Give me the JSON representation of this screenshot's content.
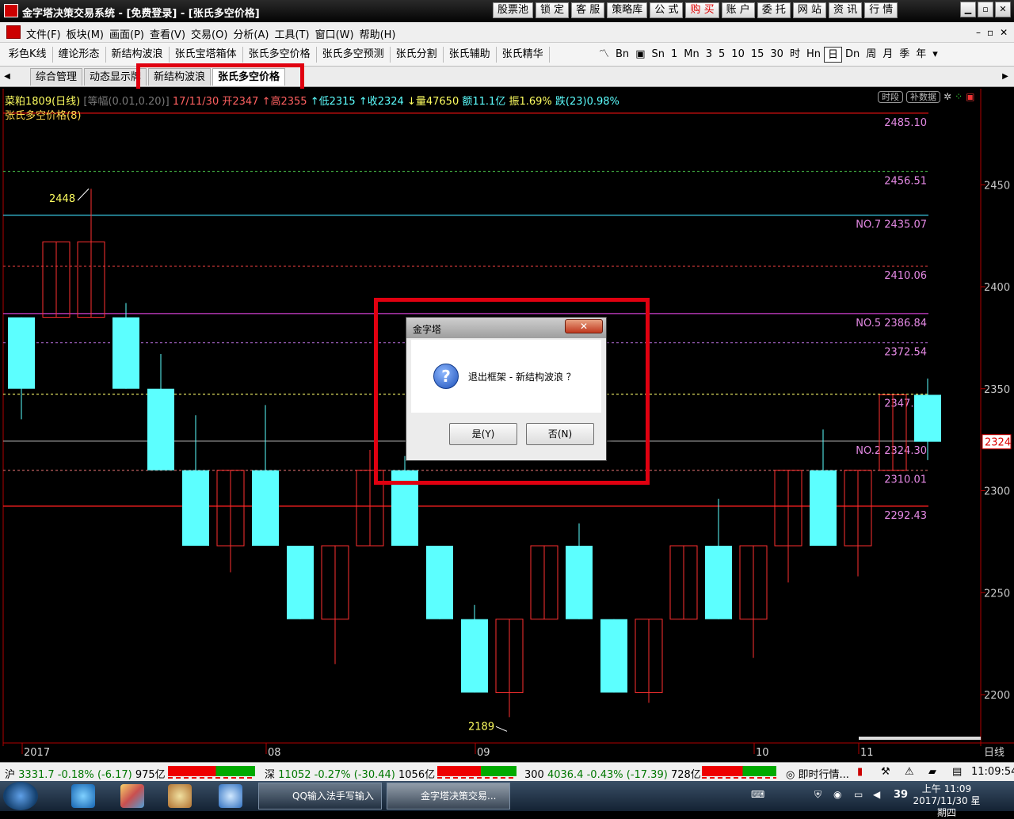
{
  "window": {
    "title": "金字塔决策交易系统 - [免费登录] - [张氏多空价格]",
    "top_buttons": [
      "股票池",
      "锁 定",
      "客 服",
      "策略库",
      "公 式",
      "购 买",
      "账 户",
      "委 托",
      "网 站",
      "资 讯",
      "行 情"
    ],
    "controls": [
      "▁",
      "▫",
      "✕"
    ]
  },
  "menu": {
    "items": [
      "文件(F)",
      "板块(M)",
      "画面(P)",
      "查看(V)",
      "交易(O)",
      "分析(A)",
      "工具(T)",
      "窗口(W)",
      "帮助(H)"
    ],
    "child_controls": [
      "–",
      "▫",
      "✕"
    ]
  },
  "toolbar": {
    "items": [
      "彩色K线",
      "缠论形态",
      "新结构波浪",
      "张氏宝塔箱体",
      "张氏多空价格",
      "张氏多空预测",
      "张氏分割",
      "张氏辅助",
      "张氏精华"
    ],
    "periods": [
      "Bn",
      "Sn",
      "1",
      "Mn",
      "3",
      "5",
      "10",
      "15",
      "30",
      "时",
      "Hn",
      "日",
      "Dn",
      "周",
      "月",
      "季",
      "年"
    ],
    "selected_period": "日"
  },
  "tabs": {
    "items": [
      "综合管理",
      "动态显示牌",
      "新结构波浪",
      "张氏多空价格"
    ],
    "active": "张氏多空价格"
  },
  "chart": {
    "info": {
      "symbol": "菜粕1809(日线)",
      "scale": "[等幅(0.01,0.20)]",
      "date": "17/11/30",
      "open": "开2347",
      "high": "↑高2355",
      "low": "↑低2315",
      "close": "↑收2324",
      "vol": "↓量47650",
      "amount": "额11.1亿",
      "amp": "振1.69%",
      "change": "跌(23)0.98%"
    },
    "indicator": "张氏多空价格(8)",
    "buttons": [
      "时段",
      "补数据"
    ],
    "level_labels": [
      "2485.10",
      "2456.51",
      "NO.7 2435.07",
      "2410.06",
      "NO.5 2386.84",
      "2372.54",
      "2347.33",
      "NO.2 2324.30",
      "2310.01",
      "2292.43"
    ],
    "y_ticks": [
      "2450",
      "2400",
      "2350",
      "2300",
      "2250",
      "2200"
    ],
    "x_labels": [
      "2017",
      "08",
      "09",
      "10",
      "11"
    ],
    "period_label": "日线",
    "last_price": "2324",
    "high_mark": "2448",
    "low_mark": "2189"
  },
  "chart_data": {
    "type": "candlestick",
    "ylim": [
      2180,
      2500
    ],
    "candles": [
      {
        "o": 2385,
        "c": 2350,
        "h": 2385,
        "l": 2335
      },
      {
        "o": 2385,
        "c": 2422,
        "h": 2422,
        "l": 2385
      },
      {
        "o": 2385,
        "c": 2422,
        "h": 2448,
        "l": 2385
      },
      {
        "o": 2385,
        "c": 2350,
        "h": 2392,
        "l": 2350
      },
      {
        "o": 2350,
        "c": 2310,
        "h": 2367,
        "l": 2310
      },
      {
        "o": 2310,
        "c": 2273,
        "h": 2337,
        "l": 2273
      },
      {
        "o": 2273,
        "c": 2310,
        "h": 2310,
        "l": 2260
      },
      {
        "o": 2310,
        "c": 2273,
        "h": 2342,
        "l": 2273
      },
      {
        "o": 2273,
        "c": 2237,
        "h": 2273,
        "l": 2237
      },
      {
        "o": 2237,
        "c": 2273,
        "h": 2273,
        "l": 2215
      },
      {
        "o": 2273,
        "c": 2310,
        "h": 2320,
        "l": 2273
      },
      {
        "o": 2310,
        "c": 2273,
        "h": 2317,
        "l": 2273
      },
      {
        "o": 2273,
        "c": 2237,
        "h": 2273,
        "l": 2237
      },
      {
        "o": 2237,
        "c": 2201,
        "h": 2244,
        "l": 2201
      },
      {
        "o": 2201,
        "c": 2237,
        "h": 2237,
        "l": 2189
      },
      {
        "o": 2237,
        "c": 2273,
        "h": 2273,
        "l": 2237
      },
      {
        "o": 2273,
        "c": 2237,
        "h": 2284,
        "l": 2237
      },
      {
        "o": 2237,
        "c": 2201,
        "h": 2237,
        "l": 2201
      },
      {
        "o": 2201,
        "c": 2237,
        "h": 2237,
        "l": 2196
      },
      {
        "o": 2237,
        "c": 2273,
        "h": 2273,
        "l": 2237
      },
      {
        "o": 2273,
        "c": 2237,
        "h": 2296,
        "l": 2237
      },
      {
        "o": 2237,
        "c": 2273,
        "h": 2273,
        "l": 2218
      },
      {
        "o": 2273,
        "c": 2310,
        "h": 2310,
        "l": 2255
      },
      {
        "o": 2310,
        "c": 2273,
        "h": 2330,
        "l": 2273
      },
      {
        "o": 2273,
        "c": 2310,
        "h": 2310,
        "l": 2258
      },
      {
        "o": 2310,
        "c": 2347,
        "h": 2347,
        "l": 2310
      },
      {
        "o": 2347,
        "c": 2324,
        "h": 2355,
        "l": 2315
      }
    ],
    "levels": [
      {
        "v": 2485.1,
        "c": "#e01010"
      },
      {
        "v": 2456.51,
        "c": "#3a9a3a",
        "dash": true
      },
      {
        "v": 2435.07,
        "c": "#40e0ff"
      },
      {
        "v": 2410.06,
        "c": "#b03030",
        "dash": true
      },
      {
        "v": 2386.84,
        "c": "#d040d0"
      },
      {
        "v": 2372.54,
        "c": "#a060c0",
        "dash": true
      },
      {
        "v": 2347.33,
        "c": "#e0e060",
        "dash": true
      },
      {
        "v": 2324.3,
        "c": "#a0a0a0"
      },
      {
        "v": 2310.01,
        "c": "#c06060",
        "dash": true
      },
      {
        "v": 2292.43,
        "c": "#ff2020"
      }
    ]
  },
  "dialog": {
    "title": "金字塔",
    "close": "✕",
    "message": "退出框架 - 新结构波浪 ？",
    "yes": "是(Y)",
    "no": "否(N)"
  },
  "status": {
    "sh": {
      "name": "沪",
      "price": "3331.7",
      "pct": "-0.18%",
      "chg": "(-6.17)",
      "amt": "975亿"
    },
    "sz": {
      "name": "深",
      "price": "11052",
      "pct": "-0.27%",
      "chg": "(-30.44)",
      "amt": "1056亿"
    },
    "i300": {
      "name": "300",
      "price": "4036.4",
      "pct": "-0.43%",
      "chg": "(-17.39)",
      "amt": "728亿"
    },
    "live": "即时行情...",
    "time": "11:09:54"
  },
  "taskbar": {
    "apps": [
      "QQ输入法手写输入",
      "金字塔决策交易..."
    ],
    "clock_time": "上午 11:09",
    "clock_date": "2017/11/30 星期四",
    "tray_num": "39"
  },
  "colors": {
    "up_candle": "#ff3030",
    "down_candle": "#5cffff",
    "highlight": "#e00010"
  }
}
